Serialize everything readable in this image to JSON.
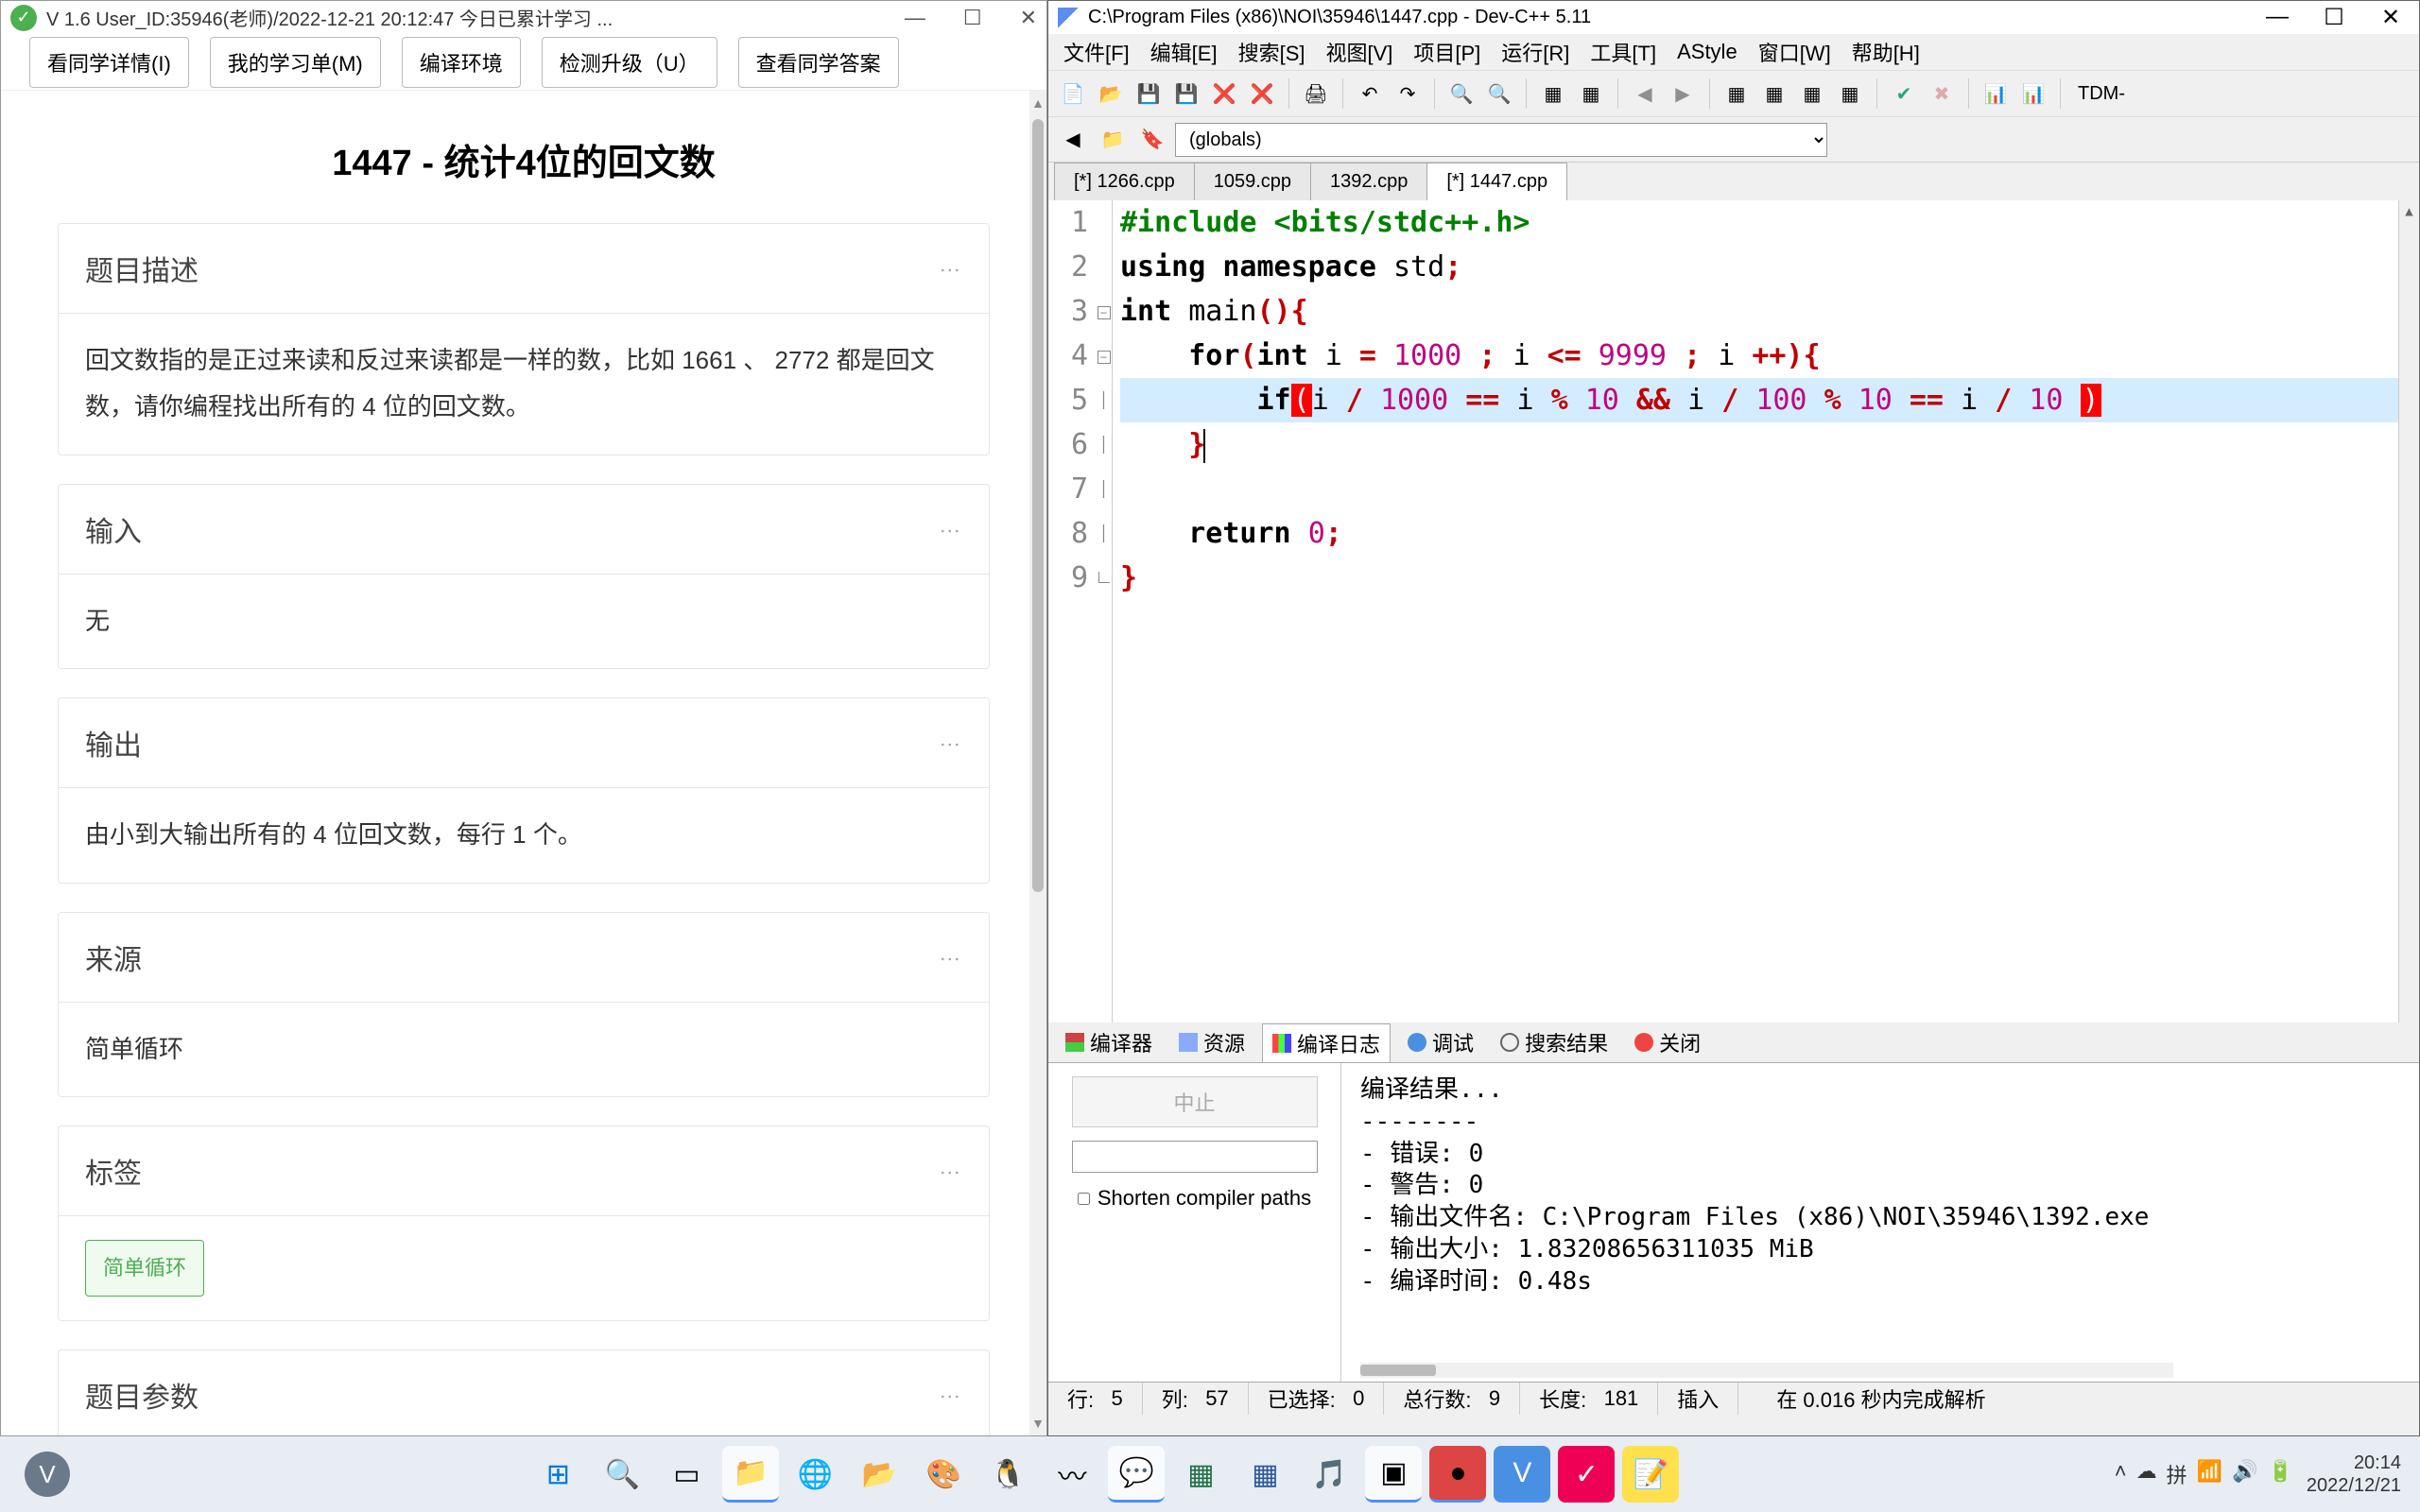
{
  "left": {
    "title": "V 1.6 User_ID:35946(老师)/2022-12-21 20:12:47 今日已累计学习 ...",
    "toolbar": {
      "btn1": "看同学详情(I)",
      "btn2": "我的学习单(M)",
      "btn3": "编译环境",
      "btn4": "检测升级（U）",
      "btn5": "查看同学答案"
    },
    "problem_title": "1447 - 统计4位的回文数",
    "sections": {
      "desc_h": "题目描述",
      "desc_b": "回文数指的是正过来读和反过来读都是一样的数，比如 1661 、 2772 都是回文数，请你编程找出所有的 4 位的回文数。",
      "input_h": "输入",
      "input_b": "无",
      "output_h": "输出",
      "output_b": "由小到大输出所有的 4 位回文数，每行 1 个。",
      "source_h": "来源",
      "source_b": "简单循环",
      "tags_h": "标签",
      "tags_b": "简单循环",
      "params_h": "题目参数"
    }
  },
  "right": {
    "title": "C:\\Program Files (x86)\\NOI\\35946\\1447.cpp - Dev-C++ 5.11",
    "menu": [
      "文件[F]",
      "编辑[E]",
      "搜索[S]",
      "视图[V]",
      "项目[P]",
      "运行[R]",
      "工具[T]",
      "AStyle",
      "窗口[W]",
      "帮助[H]"
    ],
    "globals": "(globals)",
    "tabs": [
      "[*] 1266.cpp",
      "1059.cpp",
      "1392.cpp",
      "[*] 1447.cpp"
    ],
    "active_tab": 3,
    "tdm_label": "TDM-",
    "code_lines": {
      "l1": "#include <bits/stdc++.h>",
      "l2_a": "using",
      "l2_b": "namespace",
      "l2_c": "std",
      "l3_a": "int",
      "l3_b": "main",
      "l4_a": "for",
      "l4_b": "int",
      "l4_c": "i",
      "l4_d": "1000",
      "l4_e": "i",
      "l4_f": "9999",
      "l4_g": "i",
      "l5_a": "if",
      "l5_b": "i",
      "l5_c": "1000",
      "l5_d": "i",
      "l5_e": "10",
      "l5_f": "i",
      "l5_g": "100",
      "l5_h": "10",
      "l5_i": "i",
      "l5_j": "10",
      "l8_a": "return",
      "l8_b": "0"
    },
    "bottom_tabs": {
      "compiler": "编译器",
      "resource": "资源",
      "log": "编译日志",
      "debug": "调试",
      "search": "搜索结果",
      "close": "关闭"
    },
    "abort": "中止",
    "shorten": "Shorten compiler paths",
    "compile_output": "编译结果...\n--------\n- 错误: 0\n- 警告: 0\n- 输出文件名: C:\\Program Files (x86)\\NOI\\35946\\1392.exe\n- 输出大小: 1.83208656311035 MiB\n- 编译时间: 0.48s",
    "status": {
      "row_l": "行:",
      "row_v": "5",
      "col_l": "列:",
      "col_v": "57",
      "sel_l": "已选择:",
      "sel_v": "0",
      "tot_l": "总行数:",
      "tot_v": "9",
      "len_l": "长度:",
      "len_v": "181",
      "ins": "插入",
      "parse": "在 0.016 秒内完成解析"
    }
  },
  "taskbar": {
    "time": "20:14",
    "date": "2022/12/21"
  }
}
